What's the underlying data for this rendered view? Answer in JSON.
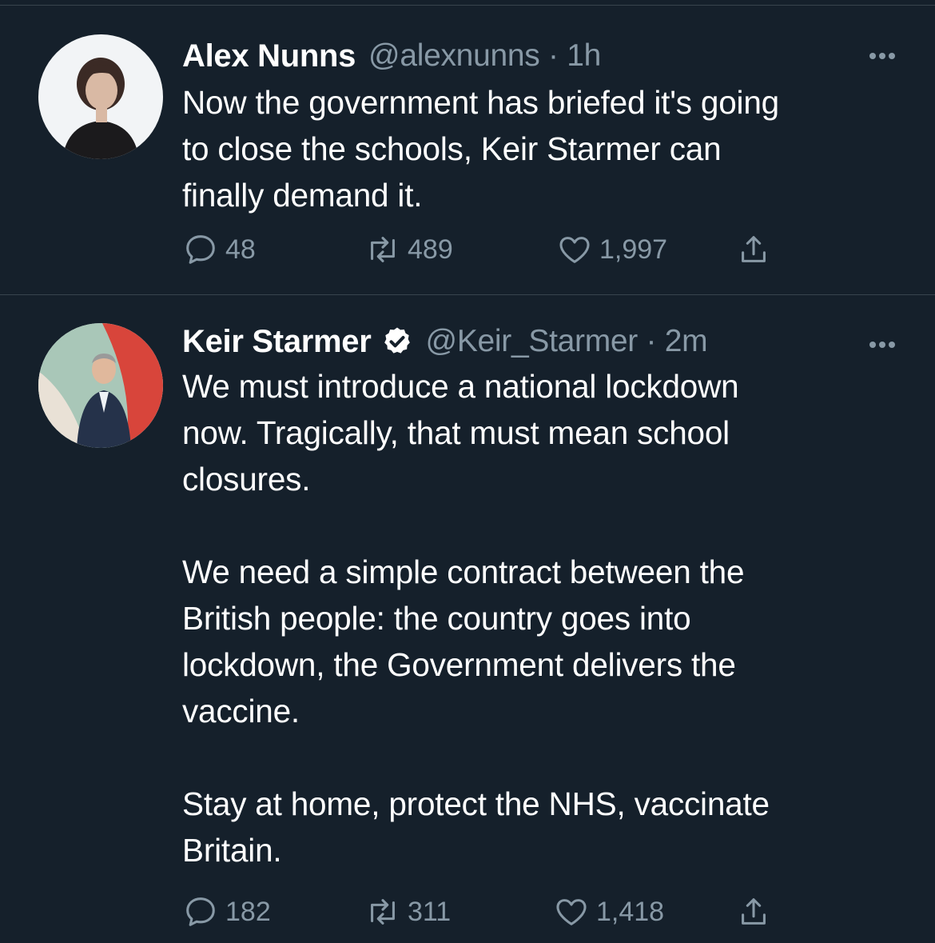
{
  "tweets": [
    {
      "name": "Alex Nunns",
      "handle": "@alexnunns · 1h",
      "verified": false,
      "text": "Now the government has briefed it's going\nto close the schools, Keir Starmer can\nfinally demand it.",
      "replies": "48",
      "retweets": "489",
      "likes": "1,997"
    },
    {
      "name": "Keir Starmer",
      "handle": "@Keir_Starmer · 2m",
      "verified": true,
      "text": "We must introduce a national lockdown\nnow. Tragically, that must mean school\nclosures.\n\nWe need a simple contract between the\nBritish people: the country goes into\nlockdown, the Government delivers the\nvaccine.\n\nStay at home, protect the NHS, vaccinate\nBritain.",
      "replies": "182",
      "retweets": "311",
      "likes": "1,418"
    }
  ],
  "icons": {
    "reply": "speech-bubble",
    "retweet": "retweet-arrows",
    "like": "heart",
    "share": "upload-arrow",
    "more": "three-dots",
    "verified": "verified-badge"
  },
  "colors": {
    "background": "#15202b",
    "text": "#ffffff",
    "muted": "#8899a6",
    "divider": "#38444d"
  }
}
